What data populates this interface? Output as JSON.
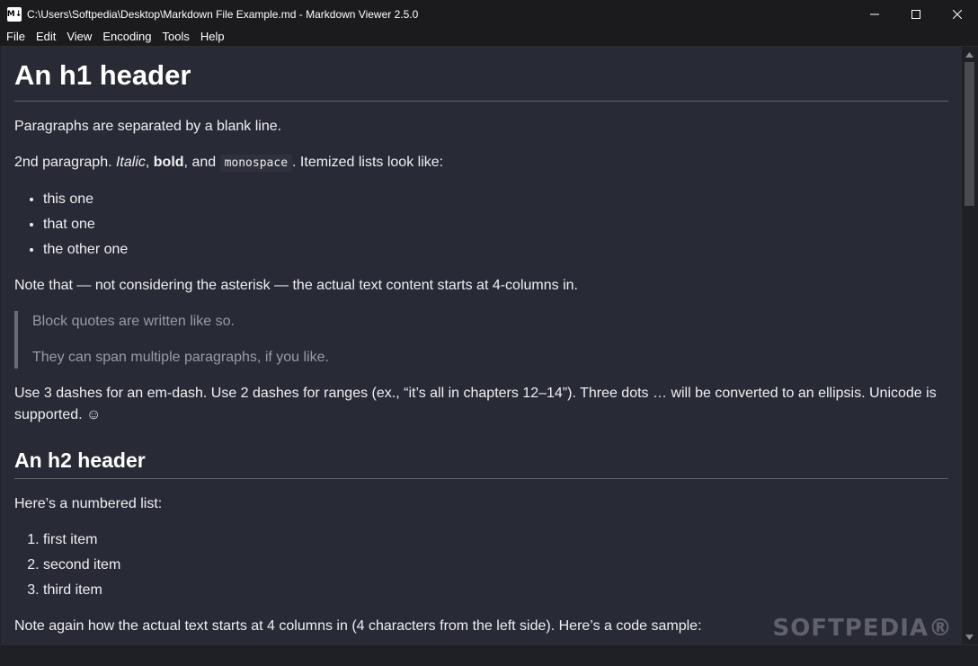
{
  "window": {
    "title": "C:\\Users\\Softpedia\\Desktop\\Markdown File Example.md - Markdown Viewer 2.5.0",
    "app_icon_text": "M↓"
  },
  "menu": [
    "File",
    "Edit",
    "View",
    "Encoding",
    "Tools",
    "Help"
  ],
  "doc": {
    "h1": "An h1 header",
    "p1": "Paragraphs are separated by a blank line.",
    "p2": {
      "a": "2nd paragraph. ",
      "italic": "Italic",
      "b": ", ",
      "bold": "bold",
      "c": ", and ",
      "code": "monospace",
      "d": ". Itemized lists look like:"
    },
    "bullets": [
      "this one",
      "that one",
      "the other one"
    ],
    "p3": "Note that — not considering the asterisk — the actual text content starts at 4-columns in.",
    "quote": [
      "Block quotes are written like so.",
      "They can span multiple paragraphs, if you like."
    ],
    "p4": "Use 3 dashes for an em-dash. Use 2 dashes for ranges (ex., “it’s all in chapters 12–14”). Three dots … will be converted to an ellipsis. Unicode is supported. ☺",
    "h2": "An h2 header",
    "p5": "Here’s a numbered list:",
    "numbered": [
      "first item",
      "second item",
      "third item"
    ],
    "p6": "Note again how the actual text starts at 4 columns in (4 characters from the left side). Here’s a code sample:"
  },
  "watermark": "SOFTPEDIA®",
  "colors": {
    "background": "#282a36",
    "titlebar": "#1b1b1d",
    "text": "#f0f0f0",
    "quote_text": "#9a9ca4"
  }
}
